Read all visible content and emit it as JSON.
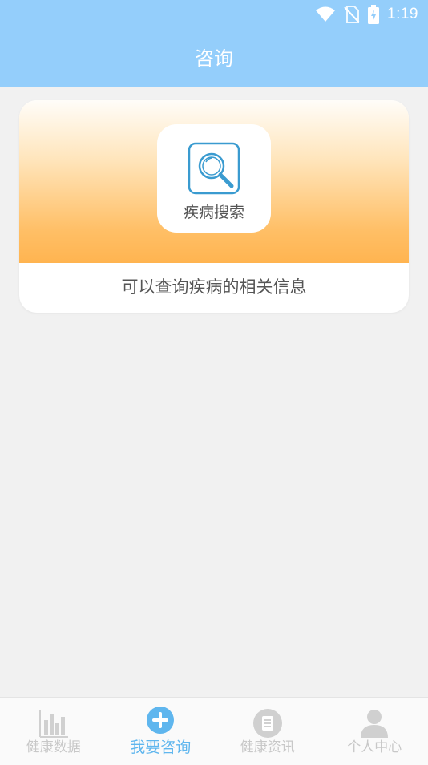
{
  "status_bar": {
    "time": "1:19"
  },
  "header": {
    "title": "咨询"
  },
  "card": {
    "tile_label": "疾病搜索",
    "description": "可以查询疾病的相关信息"
  },
  "tabbar": {
    "items": [
      {
        "label": "健康数据",
        "icon": "bar-chart-icon",
        "active": false
      },
      {
        "label": "我要咨询",
        "icon": "plus-circle-icon",
        "active": true
      },
      {
        "label": "健康资讯",
        "icon": "news-icon",
        "active": false
      },
      {
        "label": "个人中心",
        "icon": "person-icon",
        "active": false
      }
    ]
  },
  "colors": {
    "header": "#94cefb",
    "accent": "#5fb6ee",
    "banner_orange": "#ffb450",
    "inactive_tab": "#c8c8c8"
  }
}
